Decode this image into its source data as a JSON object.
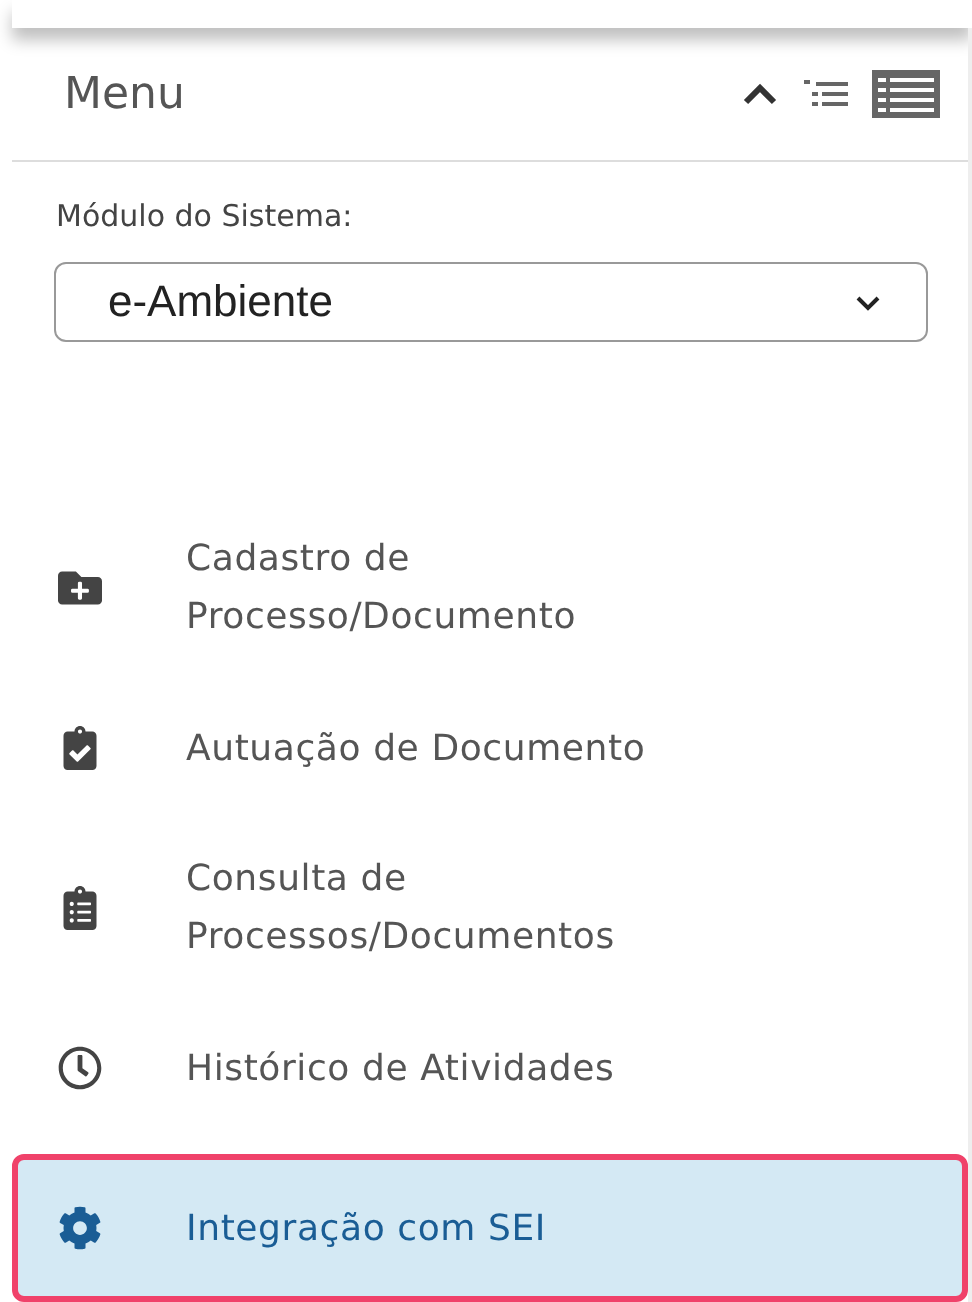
{
  "header": {
    "title": "Menu"
  },
  "module": {
    "label": "Módulo do Sistema:",
    "value": "e-Ambiente"
  },
  "items": [
    {
      "label": "Cadastro de Processo/Documento",
      "selected": false
    },
    {
      "label": "Autuação de Documento",
      "selected": false
    },
    {
      "label": "Consulta de Processos/Documentos",
      "selected": false
    },
    {
      "label": "Histórico de Atividades",
      "selected": false
    },
    {
      "label": "Integração com SEI",
      "selected": true
    }
  ]
}
